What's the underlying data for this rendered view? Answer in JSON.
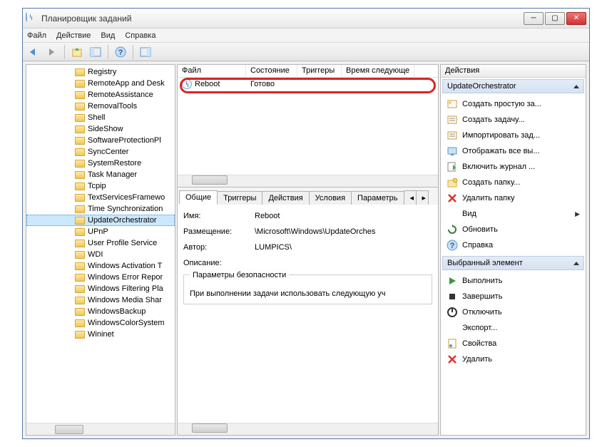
{
  "window": {
    "title": "Планировщик заданий"
  },
  "menu": {
    "file": "Файл",
    "action": "Действие",
    "view": "Вид",
    "help": "Справка"
  },
  "tree": {
    "items": [
      "Registry",
      "RemoteApp and Desk",
      "RemoteAssistance",
      "RemovalTools",
      "Shell",
      "SideShow",
      "SoftwareProtectionPl",
      "SyncCenter",
      "SystemRestore",
      "Task Manager",
      "Tcpip",
      "TextServicesFramewo",
      "Time Synchronization",
      "UpdateOrchestrator",
      "UPnP",
      "User Profile Service",
      "WDI",
      "Windows Activation T",
      "Windows Error Repor",
      "Windows Filtering Pla",
      "Windows Media Shar",
      "WindowsBackup",
      "WindowsColorSystem",
      "Wininet"
    ],
    "selected_index": 13
  },
  "task_columns": {
    "file": "Файл",
    "state": "Состояние",
    "triggers": "Триггеры",
    "next": "Время следующе"
  },
  "task_row": {
    "name": "Reboot",
    "state": "Готово"
  },
  "tabs": {
    "general": "Общие",
    "triggers": "Триггеры",
    "actions": "Действия",
    "conditions": "Условия",
    "settings": "Параметрь"
  },
  "details": {
    "name_lbl": "Имя:",
    "name_val": "Reboot",
    "loc_lbl": "Размещение:",
    "loc_val": "\\Microsoft\\Windows\\UpdateOrches",
    "author_lbl": "Автор:",
    "author_val": "LUMPICS\\",
    "desc_lbl": "Описание:",
    "security_title": "Параметры безопасности",
    "security_text": "При выполнении задачи использовать следующую уч"
  },
  "actions_panel": {
    "title": "Действия",
    "section1": "UpdateOrchestrator",
    "items1": [
      "Создать простую за...",
      "Создать задачу...",
      "Импортировать зад...",
      "Отображать все вы...",
      "Включить журнал ...",
      "Создать папку...",
      "Удалить папку",
      "Вид",
      "Обновить",
      "Справка"
    ],
    "section2": "Выбранный элемент",
    "items2": [
      "Выполнить",
      "Завершить",
      "Отключить",
      "Экспорт...",
      "Свойства",
      "Удалить"
    ]
  }
}
